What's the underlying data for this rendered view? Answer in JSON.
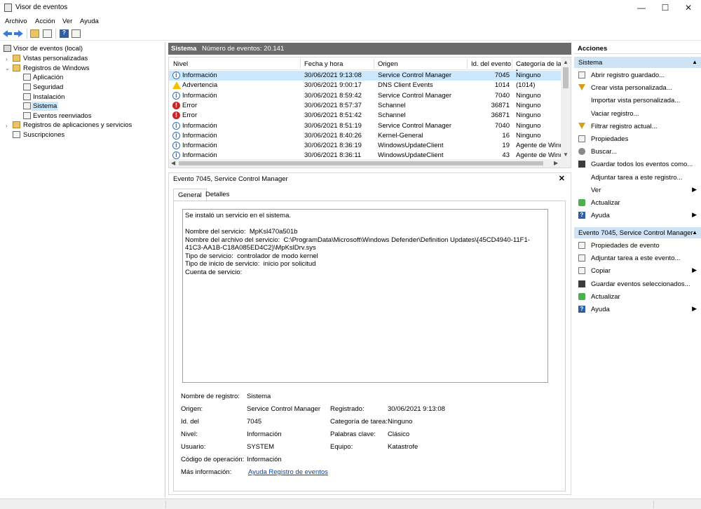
{
  "window": {
    "title": "Visor de eventos",
    "minimize": "—",
    "maximize": "☐",
    "close": "✕"
  },
  "menu": [
    "Archivo",
    "Acción",
    "Ver",
    "Ayuda"
  ],
  "tree": {
    "root": "Visor de eventos (local)",
    "custom_views": "Vistas personalizadas",
    "windows_logs": "Registros de Windows",
    "logs": [
      "Aplicación",
      "Seguridad",
      "Instalación",
      "Sistema",
      "Eventos reenviados"
    ],
    "app_services": "Registros de aplicaciones y servicios",
    "subscriptions": "Suscripciones"
  },
  "pane": {
    "name": "Sistema",
    "count": "Número de eventos: 20.141"
  },
  "grid": {
    "columns": [
      "Nivel",
      "Fecha y hora",
      "Origen",
      "Id. del evento",
      "Categoría de la t"
    ],
    "rows": [
      {
        "level": "Información",
        "type": "info",
        "date": "30/06/2021 9:13:08",
        "source": "Service Control Manager",
        "id": "7045",
        "cat": "Ninguno"
      },
      {
        "level": "Advertencia",
        "type": "warn",
        "date": "30/06/2021 9:00:17",
        "source": "DNS Client Events",
        "id": "1014",
        "cat": "(1014)"
      },
      {
        "level": "Información",
        "type": "info",
        "date": "30/06/2021 8:59:42",
        "source": "Service Control Manager",
        "id": "7040",
        "cat": "Ninguno"
      },
      {
        "level": "Error",
        "type": "err",
        "date": "30/06/2021 8:57:37",
        "source": "Schannel",
        "id": "36871",
        "cat": "Ninguno"
      },
      {
        "level": "Error",
        "type": "err",
        "date": "30/06/2021 8:51:42",
        "source": "Schannel",
        "id": "36871",
        "cat": "Ninguno"
      },
      {
        "level": "Información",
        "type": "info",
        "date": "30/06/2021 8:51:19",
        "source": "Service Control Manager",
        "id": "7040",
        "cat": "Ninguno"
      },
      {
        "level": "Información",
        "type": "info",
        "date": "30/06/2021 8:40:26",
        "source": "Kernel-General",
        "id": "16",
        "cat": "Ninguno"
      },
      {
        "level": "Información",
        "type": "info",
        "date": "30/06/2021 8:36:19",
        "source": "WindowsUpdateClient",
        "id": "19",
        "cat": "Agente de Wind"
      },
      {
        "level": "Información",
        "type": "info",
        "date": "30/06/2021 8:36:11",
        "source": "WindowsUpdateClient",
        "id": "43",
        "cat": "Agente de Wind"
      }
    ]
  },
  "detail": {
    "title": "Evento 7045, Service Control Manager",
    "close": "✕",
    "tabs": [
      "General",
      "Detalles"
    ],
    "message": "Se instaló un servicio en el sistema.\n\nNombre del servicio:  MpKsl470a501b\nNombre del archivo del servicio:  C:\\ProgramData\\Microsoft\\Windows Defender\\Definition Updates\\{45CD4940-11F1-41C3-AA1B-C18A085ED4C2}\\MpKslDrv.sys\nTipo de servicio:  controlador de modo kernel\nTipo de inicio de servicio:  inicio por solicitud\nCuenta de servicio:",
    "props": {
      "log_name_label": "Nombre de registro:",
      "log_name": "Sistema",
      "source_label": "Origen:",
      "source": "Service Control Manager",
      "logged_label": "Registrado:",
      "logged": "30/06/2021 9:13:08",
      "id_label": "Id. del",
      "id": "7045",
      "task_label": "Categoría de tarea:",
      "task": "Ninguno",
      "level_label": "Nivel:",
      "level": "Información",
      "keywords_label": "Palabras clave:",
      "keywords": "Clásico",
      "user_label": "Usuario:",
      "user": "SYSTEM",
      "computer_label": "Equipo:",
      "computer": "Katastrofe",
      "opcode_label": "Código de operación:",
      "opcode": "Información",
      "more_label": "Más información:",
      "more_link": "Ayuda Registro de eventos"
    }
  },
  "actions": {
    "header": "Acciones",
    "section1": "Sistema",
    "items1": [
      {
        "label": "Abrir registro guardado...",
        "icon": "folder-icon"
      },
      {
        "label": "Crear vista personalizada...",
        "icon": "filter-icon"
      },
      {
        "label": "Importar vista personalizada...",
        "icon": ""
      },
      {
        "label": "Vaciar registro...",
        "icon": ""
      },
      {
        "label": "Filtrar registro actual...",
        "icon": "filter-icon"
      },
      {
        "label": "Propiedades",
        "icon": "document-icon"
      },
      {
        "label": "Buscar...",
        "icon": "binoculars-icon"
      },
      {
        "label": "Guardar todos los eventos como...",
        "icon": "save-icon"
      },
      {
        "label": "Adjuntar tarea a este registro...",
        "icon": ""
      },
      {
        "label": "Ver",
        "icon": "",
        "submenu": "▶"
      },
      {
        "label": "Actualizar",
        "icon": "refresh-icon"
      },
      {
        "label": "Ayuda",
        "icon": "help-icon",
        "submenu": "▶"
      }
    ],
    "section2": "Evento 7045, Service Control Manager",
    "items2": [
      {
        "label": "Propiedades de evento",
        "icon": "document-icon"
      },
      {
        "label": "Adjuntar tarea a este evento...",
        "icon": "task-icon"
      },
      {
        "label": "Copiar",
        "icon": "copy-icon",
        "submenu": "▶"
      },
      {
        "label": "Guardar eventos seleccionados...",
        "icon": "save-icon"
      },
      {
        "label": "Actualizar",
        "icon": "refresh-icon"
      },
      {
        "label": "Ayuda",
        "icon": "help-icon",
        "submenu": "▶"
      }
    ],
    "collapse": "▲"
  }
}
